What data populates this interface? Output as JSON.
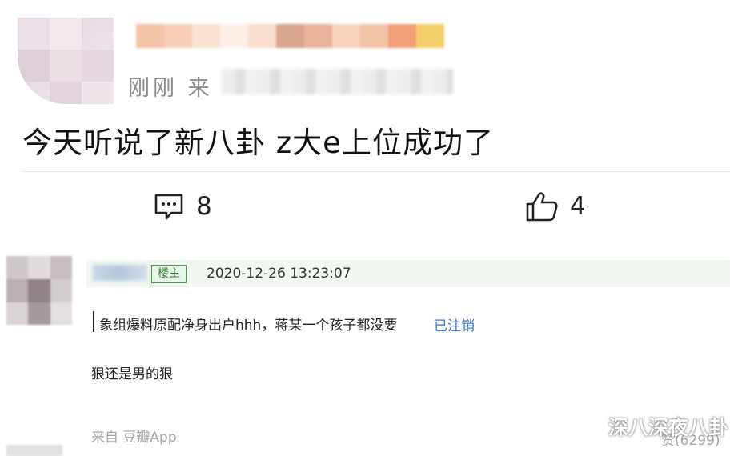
{
  "post": {
    "time_text": "刚刚 来",
    "content": "今天听说了新八卦 z大e上位成功了",
    "comment_count": "8",
    "like_count": "4"
  },
  "reply": {
    "op_badge": "楼主",
    "timestamp": "2020-12-26 13:23:07",
    "quote_text": "象组爆料原配净身出户hhh，蒋某一个孩子都没要",
    "quote_status": "已注销",
    "content": "狠还是男的狠",
    "source": "来自 豆瓣App",
    "like_text": "赞(6299)"
  },
  "watermark": {
    "text": "深八深夜八卦",
    "icon": "wechat-icon"
  },
  "colors": {
    "op_badge": "#43a047",
    "link_blue": "#3a78c2",
    "header_bar": "#f2f7f1",
    "muted_text": "#a4a4a4"
  }
}
